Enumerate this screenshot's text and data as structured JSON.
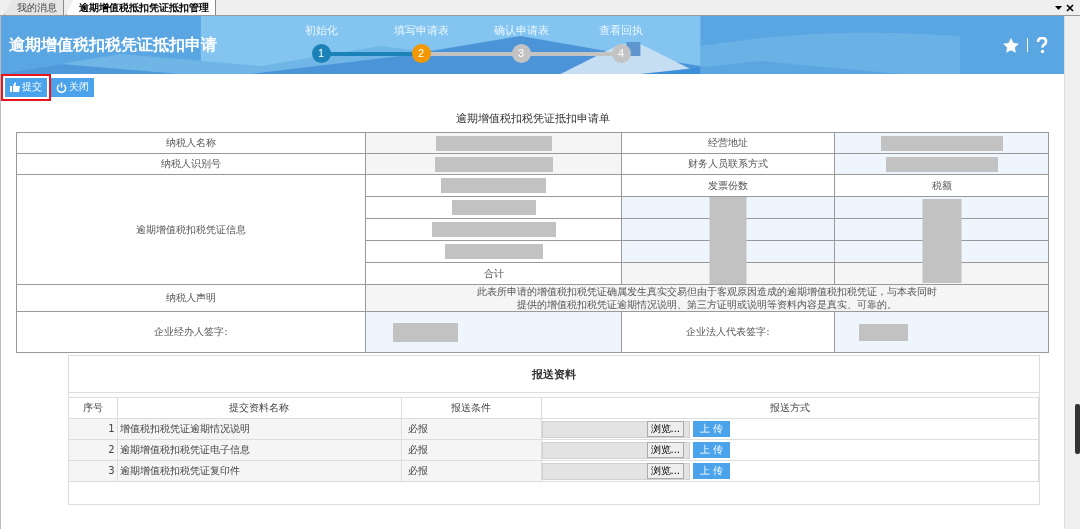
{
  "tabs": [
    {
      "label": "我的消息",
      "selected": false
    },
    {
      "label": "逾期增值税抵扣凭证抵扣管理",
      "selected": true
    }
  ],
  "header": {
    "title": "逾期增值税扣税凭证抵扣申请",
    "steps": [
      {
        "number": "1",
        "label": "初始化",
        "completed": true,
        "selected": false
      },
      {
        "number": "2",
        "label": "填写申请表",
        "completed": false,
        "selected": true
      },
      {
        "number": "3",
        "label": "确认申请表",
        "completed": false,
        "selected": false
      },
      {
        "number": "4",
        "label": "查看回执",
        "completed": false,
        "selected": false
      }
    ]
  },
  "toolbar": [
    {
      "kind": "submit",
      "label": "提交",
      "highlighted": true
    },
    {
      "kind": "close",
      "label": "关闭",
      "highlighted": false
    }
  ],
  "form": {
    "title": "逾期增值税扣税凭证抵扣申请单",
    "name_label": "纳税人名称",
    "name_value": {
      "redacted": true
    },
    "address_label": "经营地址",
    "address_value": {
      "redacted": true
    },
    "id_label": "纳税人识别号",
    "id_value": {
      "redacted": true
    },
    "contact_label": "财务人员联系方式",
    "contact_value": {
      "redacted": true
    },
    "voucher_label": "逾期增值税扣税凭证信息",
    "count_header": "发票份数",
    "tax_header": "税额",
    "vouchers": [
      {
        "redacted": true
      },
      {
        "redacted": true
      },
      {
        "redacted": true
      },
      {
        "redacted": true
      }
    ],
    "counts": {
      "redacted": true
    },
    "taxes": {
      "redacted": true
    },
    "total_label": "合计",
    "declaration_label": "纳税人声明",
    "declaration_lines": [
      "此表所申请的增值税扣税凭证确属发生真实交易但由于客观原因造成的逾期增值税扣税凭证，与本表同时",
      "提供的增值税扣税凭证逾期情况说明、第三方证明或说明等资料内容是真实、可靠的。"
    ],
    "agent_sign_label": "企业经办人签字:",
    "agent_sign_value": {
      "redacted": true
    },
    "legal_sign_label": "企业法人代表签字:",
    "legal_sign_value": {
      "redacted": true
    }
  },
  "materials": {
    "title": "报送资料",
    "columns": [
      "序号",
      "提交资料名称",
      "报送条件",
      "报送方式"
    ],
    "rows": [
      {
        "index": "1",
        "name": "增值税扣税凭证逾期情况说明",
        "condition": "必报",
        "browse_label": "浏览...",
        "upload_label": "上 传"
      },
      {
        "index": "2",
        "name": "逾期增值税扣税凭证电子信息",
        "condition": "必报",
        "browse_label": "浏览...",
        "upload_label": "上 传"
      },
      {
        "index": "3",
        "name": "逾期增值税扣税凭证复印件",
        "condition": "必报",
        "browse_label": "浏览...",
        "upload_label": "上 传"
      }
    ]
  }
}
